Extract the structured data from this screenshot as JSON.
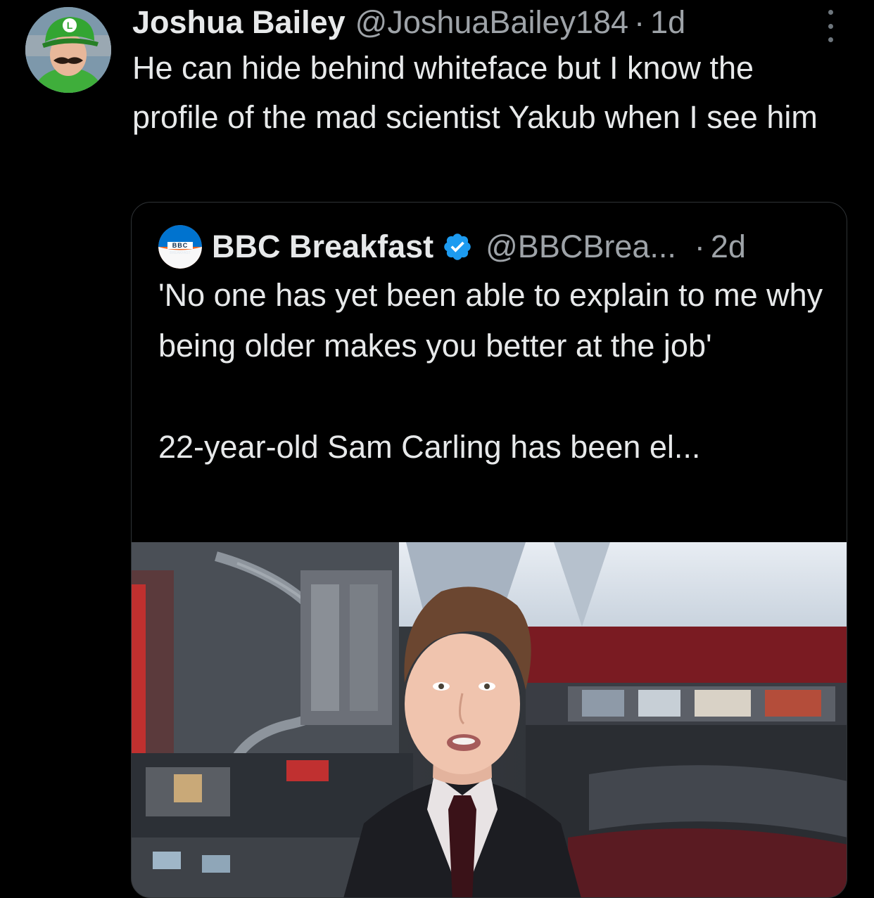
{
  "tweet": {
    "author_name": "Joshua Bailey",
    "author_handle": "@JoshuaBailey184",
    "separator": "·",
    "timestamp": "1d",
    "text": "He can hide behind whiteface but I know the profile of the mad scientist Yakub when I see him",
    "avatar_icon": "luigi-avatar-icon",
    "more_icon": "more-options-icon"
  },
  "quoted_tweet": {
    "author_name": "BBC Breakfast",
    "verified_icon": "verified-badge-icon",
    "verified_color": "#1d9bf0",
    "author_handle": "@BBCBrea...",
    "separator": "·",
    "timestamp": "2d",
    "text_line1": "'No one has yet been able to explain to me why being older makes you better at the job'",
    "text_line2": "22-year-old Sam Carling has been el...",
    "avatar_logo_text_top": "BBC",
    "avatar_logo_text_bottom": "BREAKFAST",
    "media": "news-studio-photo"
  },
  "colors": {
    "background": "#000000",
    "text_primary": "#e7e9ea",
    "text_secondary": "#9ea3a8",
    "border": "#2f3336",
    "bbc_breakfast_orange": "#f26522",
    "bbc_breakfast_blue": "#0073cf"
  }
}
